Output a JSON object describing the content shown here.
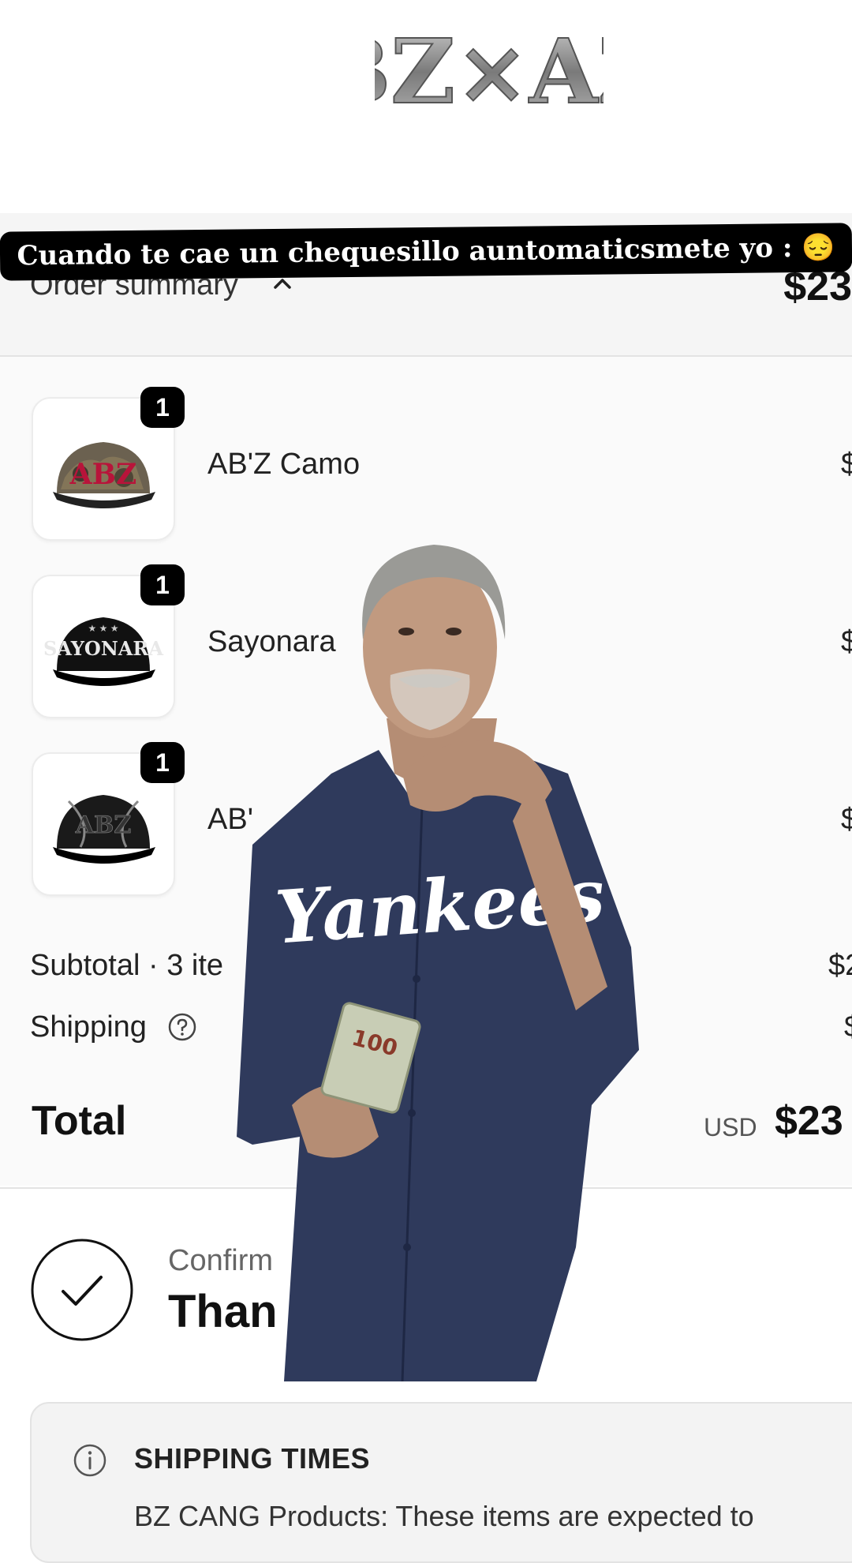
{
  "header": {
    "logo_text": "BZ×AZ"
  },
  "caption": {
    "text": "Cuando te cae un chequesillo auntomaticsmete yo : 😔"
  },
  "order_summary": {
    "label": "Order summary",
    "total": "$23",
    "icon": "chevron-up-icon"
  },
  "items": [
    {
      "name": "AB'Z Camo",
      "quantity": "1",
      "price": "$",
      "thumb": "camo-cap"
    },
    {
      "name": "Sayonara",
      "quantity": "1",
      "price": "$",
      "thumb": "sayonara-cap"
    },
    {
      "name": "AB'",
      "quantity": "1",
      "price": "$",
      "thumb": "black-abz-cap"
    }
  ],
  "subtotal": {
    "label": "Subtotal · 3 ite",
    "value": "$2"
  },
  "shipping": {
    "label": "Shipping",
    "value": "$",
    "icon": "help-circle-icon"
  },
  "total": {
    "label": "Total",
    "currency": "USD",
    "value": "$23"
  },
  "confirmation": {
    "subtitle": "Confirm",
    "title": "Than",
    "icon": "checkmark-circle-icon"
  },
  "shipping_times": {
    "title": "SHIPPING TIMES",
    "text": "BZ CANG Products: These items are expected to",
    "icon": "info-icon"
  },
  "overlay": {
    "money_label": "100",
    "jersey_text": "Yankees"
  },
  "colors": {
    "background": "#ffffff",
    "summary_bg": "#f5f5f5",
    "badge": "#000000",
    "caption_bg": "#000000",
    "jersey": "#2f3a5c"
  }
}
